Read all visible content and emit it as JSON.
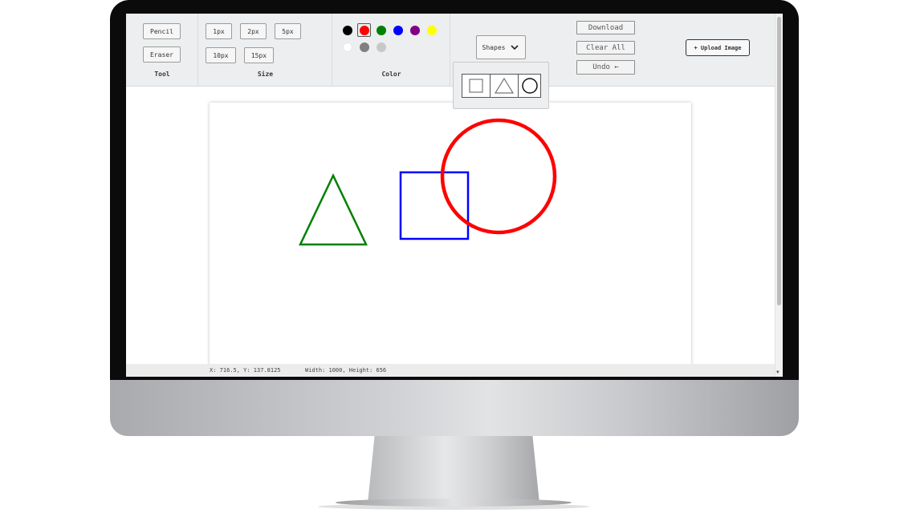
{
  "toolbar": {
    "tool": {
      "label": "Tool",
      "pencil": "Pencil",
      "eraser": "Eraser"
    },
    "size": {
      "label": "Size",
      "options": [
        "1px",
        "2px",
        "5px",
        "10px",
        "15px"
      ]
    },
    "color": {
      "label": "Color",
      "swatches": [
        "#000000",
        "#ff0000",
        "#008000",
        "#0000ff",
        "#800080",
        "#ffff00",
        "#ffffff",
        "#808080",
        "#c8c8c8"
      ],
      "selected": "#ff0000"
    },
    "shapes": {
      "label": "Shapes",
      "chevron_icon": "chevron-down-icon",
      "options": [
        "square-icon",
        "triangle-icon",
        "circle-icon"
      ]
    },
    "download": "Download",
    "clear_all": "Clear All",
    "undo": "Undo ←",
    "upload": "+ Upload Image"
  },
  "canvas": {
    "shapes": [
      {
        "type": "triangle",
        "stroke": "#008000"
      },
      {
        "type": "square",
        "stroke": "#0000ff"
      },
      {
        "type": "circle",
        "stroke": "#ff0000"
      }
    ]
  },
  "status": {
    "coords": "X: 716.5, Y: 137.8125",
    "dims": "Width: 1000, Height: 656"
  }
}
